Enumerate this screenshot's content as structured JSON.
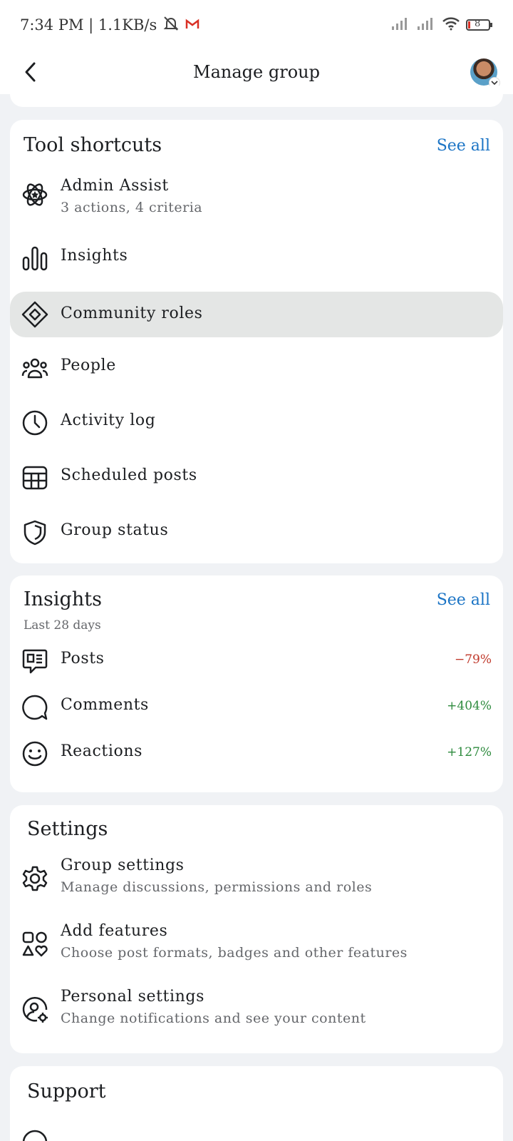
{
  "status_bar": {
    "time_speed": "7:34 PM | 1.1KB/s",
    "battery": "8"
  },
  "header": {
    "title": "Manage group"
  },
  "tool_shortcuts": {
    "title": "Tool shortcuts",
    "see_all": "See all",
    "items": [
      {
        "label": "Admin Assist",
        "sub": "3 actions, 4 criteria",
        "icon": "admin-assist-icon"
      },
      {
        "label": "Insights",
        "icon": "bar-chart-icon"
      },
      {
        "label": "Community roles",
        "icon": "diamond-icon"
      },
      {
        "label": "People",
        "icon": "people-icon"
      },
      {
        "label": "Activity log",
        "icon": "clock-icon"
      },
      {
        "label": "Scheduled posts",
        "icon": "calendar-icon"
      },
      {
        "label": "Group status",
        "icon": "shield-icon"
      }
    ]
  },
  "insights": {
    "title": "Insights",
    "subtitle": "Last 28 days",
    "see_all": "See all",
    "items": [
      {
        "label": "Posts",
        "change": "−79%",
        "icon": "post-icon"
      },
      {
        "label": "Comments",
        "change": "+404%",
        "icon": "comment-icon"
      },
      {
        "label": "Reactions",
        "change": "+127%",
        "icon": "smiley-icon"
      }
    ]
  },
  "settings": {
    "title": "Settings",
    "items": [
      {
        "label": "Group settings",
        "sub": "Manage discussions, permissions and roles",
        "icon": "gear-icon"
      },
      {
        "label": "Add features",
        "sub": "Choose post formats, badges and other features",
        "icon": "features-icon"
      },
      {
        "label": "Personal settings",
        "sub": "Change notifications and see your content",
        "icon": "personal-settings-icon"
      }
    ]
  },
  "support": {
    "title": "Support"
  },
  "colors": {
    "link": "#1b74c5",
    "negative": "#c0392b",
    "positive": "#2e8b3e",
    "highlight": "#e4e6e5"
  }
}
